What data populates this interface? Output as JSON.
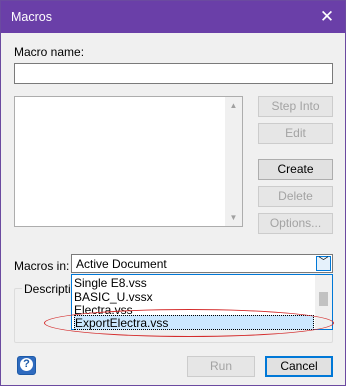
{
  "window": {
    "title": "Macros",
    "close_glyph": "✕"
  },
  "macro_name": {
    "label": "Macro name:",
    "value": ""
  },
  "buttons": {
    "step_into": "Step Into",
    "edit": "Edit",
    "create": "Create",
    "delete": "Delete",
    "options": "Options...",
    "run": "Run",
    "cancel": "Cancel"
  },
  "macros_in": {
    "label": "Macros in:",
    "selected": "Active Document"
  },
  "description": {
    "label": "Descripti"
  },
  "dropdown": {
    "options": [
      "Single E8.vss",
      "BASIC_U.vssx",
      "Electra.vss",
      "ExportElectra.vss"
    ],
    "highlighted": "ExportElectra.vss"
  },
  "icons": {
    "help": "?",
    "scroll_up": "▲",
    "scroll_down": "▼",
    "combo_arrow": "﹀"
  },
  "colors": {
    "titlebar": "#6a3fa8",
    "accent": "#0078d7",
    "annotation": "#d42c2c"
  }
}
